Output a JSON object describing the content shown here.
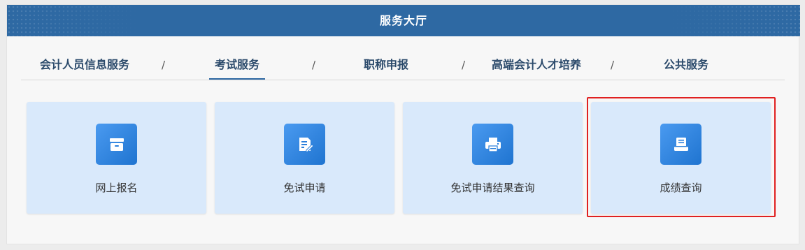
{
  "header": {
    "title": "服务大厅"
  },
  "tabs": [
    {
      "label": "会计人员信息服务",
      "active": false
    },
    {
      "label": "考试服务",
      "active": true
    },
    {
      "label": "职称申报",
      "active": false
    },
    {
      "label": "高端会计人才培养",
      "active": false
    },
    {
      "label": "公共服务",
      "active": false
    }
  ],
  "separator": "/",
  "cards": [
    {
      "label": "网上报名",
      "icon": "archive-box-icon"
    },
    {
      "label": "免试申请",
      "icon": "document-edit-icon"
    },
    {
      "label": "免试申请结果查询",
      "icon": "printer-icon"
    },
    {
      "label": "成绩查询",
      "icon": "score-report-icon",
      "highlighted": true
    }
  ],
  "colors": {
    "header_bg": "#2e69a3",
    "tab_text": "#2b4a6b",
    "card_bg": "#d9e9fb",
    "icon_bg": "#2a82e0",
    "highlight_border": "#e02020"
  }
}
